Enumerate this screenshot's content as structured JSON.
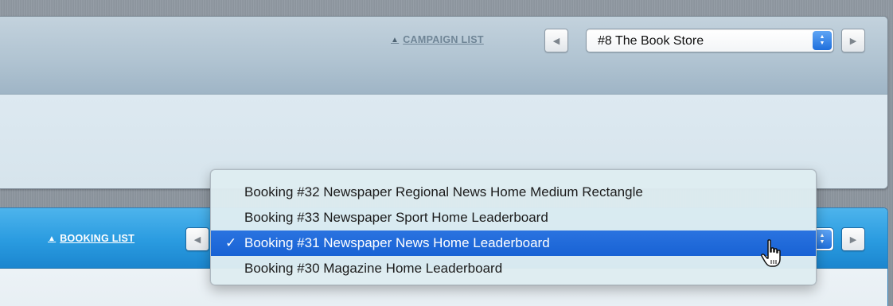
{
  "campaign": {
    "list_link": "CAMPAIGN LIST",
    "selected": "#8 The Book Store",
    "prev_icon": "◀",
    "next_icon": "▶"
  },
  "booking": {
    "list_link": "BOOKING LIST",
    "prev_icon": "◀",
    "next_icon": "▶"
  },
  "dropdown": {
    "items": [
      {
        "label": "Booking #32 Newspaper Regional News Home Medium Rectangle",
        "selected": false
      },
      {
        "label": "Booking #33 Newspaper Sport Home Leaderboard",
        "selected": false
      },
      {
        "label": "Booking #31 Newspaper News Home Leaderboard",
        "selected": true
      },
      {
        "label": "Booking #30 Magazine Home Leaderboard",
        "selected": false
      }
    ],
    "check": "✓"
  },
  "icons": {
    "triangle_up": "▲",
    "stepper_up": "▲",
    "stepper_down": "▼",
    "cursor": "hand-pointer-icon"
  },
  "colors": {
    "campaign_header": "#b1c4d2",
    "booking_header": "#2a9be0",
    "selection": "#1862d4"
  }
}
